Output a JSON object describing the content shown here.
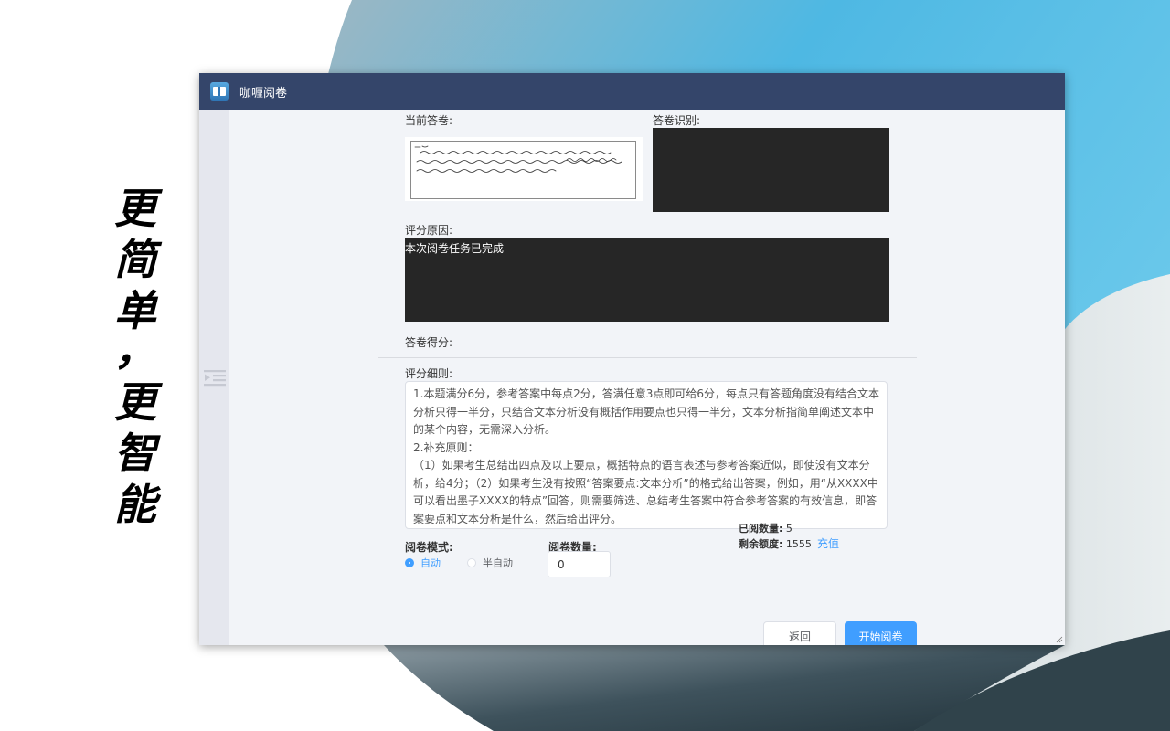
{
  "slogan": {
    "chars": [
      "更",
      "简",
      "单",
      "，",
      "更",
      "智",
      "能"
    ]
  },
  "window": {
    "title": "咖喱阅卷"
  },
  "labels": {
    "current_answer": "当前答卷:",
    "recognition": "答卷识别:",
    "reason": "评分原因:",
    "score": "答卷得分:",
    "rules": "评分细则:"
  },
  "reason_text": "本次阅卷任务已完成",
  "rules_text": "1.本题满分6分，参考答案中每点2分，答满任意3点即可给6分，每点只有答题角度没有结合文本分析只得一半分，只结合文本分析没有概括作用要点也只得一半分，文本分析指简单阐述文本中的某个内容，无需深入分析。\n2.补充原则：\n（1）如果考生总结出四点及以上要点，概括特点的语言表述与参考答案近似，即使没有文本分析，给4分；（2）如果考生没有按照“答案要点:文本分析”的格式给出答案，例如，用“从XXXX中可以看出墨子XXXX的特点”回答，则需要筛选、总结考生答案中符合参考答案的有效信息，即答案要点和文本分析是什么，然后给出评分。",
  "mode": {
    "label": "阅卷模式:",
    "options": [
      "自动",
      "半自动"
    ],
    "selected": "自动"
  },
  "count": {
    "label": "阅卷数量:",
    "value": "0"
  },
  "stats": {
    "read_label": "已阅数量:",
    "read_value": "5",
    "balance_label": "剩余额度:",
    "balance_value": "1555",
    "recharge": "充值"
  },
  "buttons": {
    "back": "返回",
    "start": "开始阅卷"
  },
  "colors": {
    "titlebar": "#34456a",
    "primary": "#409eff",
    "dark_panel": "#262626",
    "window_bg": "#f2f4f8"
  }
}
